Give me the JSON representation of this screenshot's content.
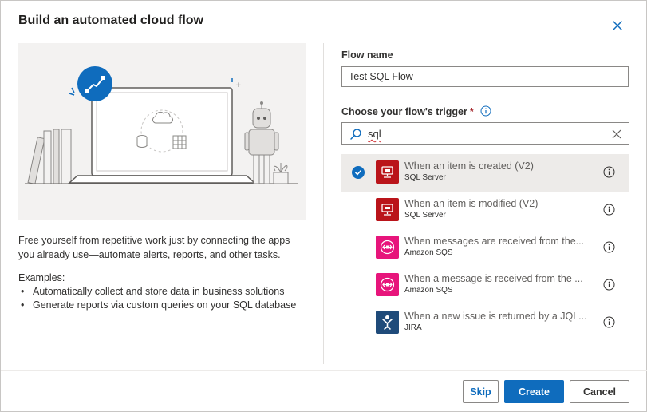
{
  "dialog": {
    "title": "Build an automated cloud flow",
    "description": "Free yourself from repetitive work just by connecting the apps you already use—automate alerts, reports, and other tasks.",
    "examples_heading": "Examples:",
    "examples": [
      "Automatically collect and store data in business solutions",
      "Generate reports via custom queries on your SQL database"
    ]
  },
  "form": {
    "flow_name_label": "Flow name",
    "flow_name_value": "Test SQL Flow",
    "trigger_label": "Choose your flow's trigger",
    "required_mark": "*",
    "search_value": "sql"
  },
  "triggers": [
    {
      "name": "When an item is created (V2)",
      "connector": "SQL Server",
      "icon": "sql-server-icon",
      "color": "#ba141a",
      "selected": true
    },
    {
      "name": "When an item is modified (V2)",
      "connector": "SQL Server",
      "icon": "sql-server-icon",
      "color": "#ba141a",
      "selected": false
    },
    {
      "name": "When messages are received from the...",
      "connector": "Amazon SQS",
      "icon": "amazon-sqs-icon",
      "color": "#e7157b",
      "selected": false
    },
    {
      "name": "When a message is received from the ...",
      "connector": "Amazon SQS",
      "icon": "amazon-sqs-icon",
      "color": "#e7157b",
      "selected": false
    },
    {
      "name": "When a new issue is returned by a JQL...",
      "connector": "JIRA",
      "icon": "jira-icon",
      "color": "#1f4b7a",
      "selected": false
    }
  ],
  "buttons": {
    "skip": "Skip",
    "create": "Create",
    "cancel": "Cancel"
  },
  "colors": {
    "accent": "#0f6cbd",
    "required": "#a4262c"
  }
}
